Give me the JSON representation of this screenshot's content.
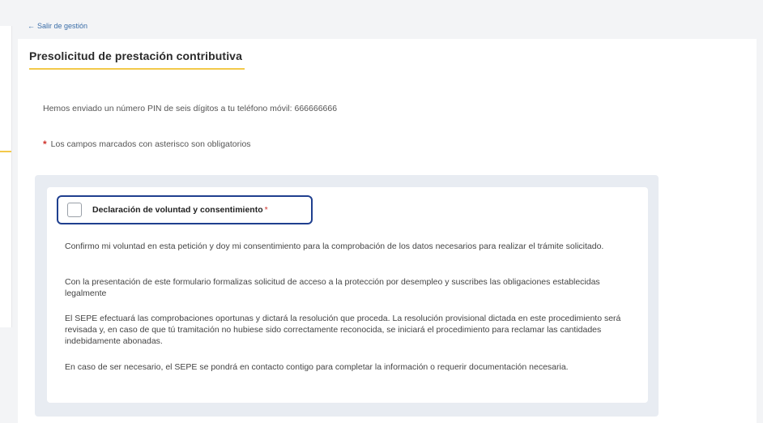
{
  "nav": {
    "back_arrow": "←",
    "back_label": "Salir de gestión"
  },
  "page": {
    "title": "Presolicitud de prestación contributiva",
    "pin_message": "Hemos enviado un número PIN de seis dígitos a tu teléfono móvil: 666666666",
    "required_star": "*",
    "required_note": "Los campos marcados con asterisco son obligatorios"
  },
  "consent": {
    "label": "Declaración de voluntad y consentimiento",
    "required_star": "*",
    "checked": false,
    "paragraphs": [
      "Confirmo mi voluntad en esta petición y doy mi consentimiento para la comprobación de los datos necesarios para realizar el trámite solicitado.",
      "Con la presentación de este formulario formalizas solicitud de acceso a la protección por desempleo y suscribes las obligaciones establecidas legalmente",
      "El SEPE efectuará las comprobaciones oportunas y dictará la resolución que proceda. La resolución provisional dictada en este procedimiento será revisada y, en caso de que tú tramitación no hubiese sido correctamente reconocida, se iniciará el procedimiento para reclamar las cantidades indebidamente abonadas.",
      "En caso de ser necesario, el SEPE se pondrá en contacto contigo para completar la información o requerir documentación necesaria."
    ]
  },
  "colors": {
    "accent_yellow": "#f3c94a",
    "focus_blue": "#1f3f8f",
    "required_red": "#d0342c",
    "link_blue": "#3b6ea8"
  }
}
